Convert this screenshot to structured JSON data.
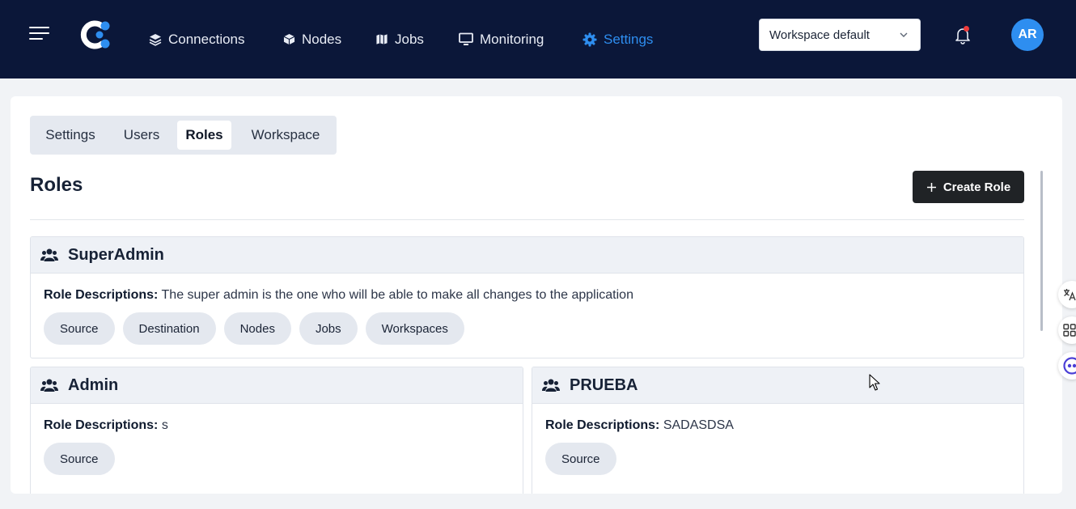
{
  "header": {
    "nav": [
      {
        "label": "Connections",
        "icon": "layers-icon"
      },
      {
        "label": "Nodes",
        "icon": "cube-icon"
      },
      {
        "label": "Jobs",
        "icon": "map-icon"
      },
      {
        "label": "Monitoring",
        "icon": "monitor-icon"
      },
      {
        "label": "Settings",
        "icon": "gear-icon",
        "active": true
      }
    ],
    "workspace_select": "Workspace default",
    "avatar_initials": "AR",
    "accent_color": "#2e8ef0",
    "background_color": "#0b1739"
  },
  "tabs": [
    {
      "label": "Settings"
    },
    {
      "label": "Users"
    },
    {
      "label": "Roles",
      "active": true
    },
    {
      "label": "Workspace"
    }
  ],
  "page": {
    "title": "Roles",
    "create_button": "Create Role"
  },
  "roles": [
    {
      "name": "SuperAdmin",
      "desc_label": "Role Descriptions:",
      "description": "The super admin is the one who will be able to make all changes to the application",
      "permissions": [
        "Source",
        "Destination",
        "Nodes",
        "Jobs",
        "Workspaces"
      ]
    },
    {
      "name": "Admin",
      "desc_label": "Role Descriptions:",
      "description": "s",
      "permissions": [
        "Source"
      ]
    },
    {
      "name": "PRUEBA",
      "desc_label": "Role Descriptions:",
      "description": "SADASDSA",
      "permissions": [
        "Source"
      ]
    }
  ],
  "side_tools": [
    "translate-icon",
    "apps-grid-icon",
    "assistant-icon"
  ]
}
